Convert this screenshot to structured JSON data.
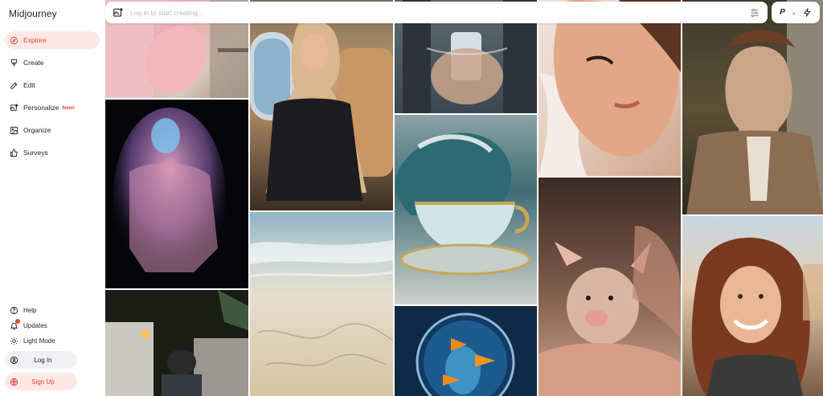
{
  "app": {
    "brand": "Midjourney"
  },
  "nav": {
    "items": [
      {
        "label": "Explore",
        "icon": "compass-icon",
        "active": true
      },
      {
        "label": "Create",
        "icon": "brush-icon"
      },
      {
        "label": "Edit",
        "icon": "pencil-icon"
      },
      {
        "label": "Personalize",
        "icon": "image-star-icon",
        "badge": "New!"
      },
      {
        "label": "Organize",
        "icon": "gallery-icon"
      },
      {
        "label": "Surveys",
        "icon": "thumbs-up-icon"
      }
    ]
  },
  "bottom": {
    "help": "Help",
    "updates": "Updates",
    "light_mode": "Light Mode",
    "login": "Log In",
    "signup": "Sign Up"
  },
  "search": {
    "placeholder": "Log in to start creating..."
  },
  "topright": {
    "profile_letter": "P",
    "chevron": "⌄"
  },
  "colors": {
    "accent": "#e2463b",
    "accent_bg": "#fde8e6",
    "pill_bg": "#eef0f3"
  }
}
